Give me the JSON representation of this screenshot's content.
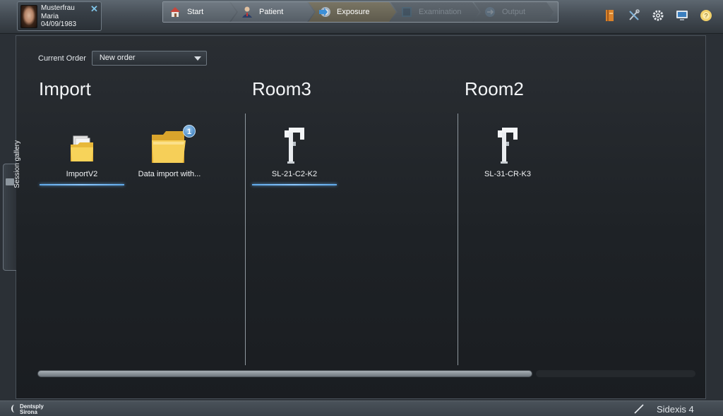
{
  "patient": {
    "last_name": "Musterfrau",
    "first_name": "Maria",
    "birth_date": "04/09/1983",
    "close_icon": "close-x-icon"
  },
  "workflow": {
    "steps": [
      {
        "label": "Start",
        "state": "normal",
        "icon": "house-icon"
      },
      {
        "label": "Patient",
        "state": "normal",
        "icon": "person-icon"
      },
      {
        "label": "Exposure",
        "state": "active",
        "icon": "exposure-icon"
      },
      {
        "label": "Examination",
        "state": "disabled",
        "icon": "examination-icon"
      },
      {
        "label": "Output",
        "state": "disabled",
        "icon": "output-icon"
      }
    ]
  },
  "toolbar": {
    "icons": [
      "book-icon",
      "tools-icon",
      "gear-icon",
      "monitor-icon",
      "help-icon"
    ]
  },
  "order": {
    "label": "Current Order",
    "selected": "New order"
  },
  "groups": [
    {
      "title": "Import",
      "devices": [
        {
          "label": "ImportV2",
          "icon": "folder-icon",
          "selected": true
        },
        {
          "label": "Data import with...",
          "icon": "folder-large-icon",
          "selected": false,
          "badge": "1"
        }
      ]
    },
    {
      "title": "Room3",
      "devices": [
        {
          "label": "SL-21-C2-K2",
          "icon": "xray-device-icon",
          "selected": true
        }
      ]
    },
    {
      "title": "Room2",
      "devices": [
        {
          "label": "SL-31-CR-K3",
          "icon": "xray-device-icon",
          "selected": false
        }
      ]
    }
  ],
  "side_tab": {
    "label": "Session gallery"
  },
  "footer": {
    "brand_line1": "Dentsply",
    "brand_line2": "Sirona",
    "product": "Sidexis 4"
  },
  "colors": {
    "accent_blue": "#5fa8e8",
    "background": "#1e2226",
    "active_step": "#6b6758"
  }
}
